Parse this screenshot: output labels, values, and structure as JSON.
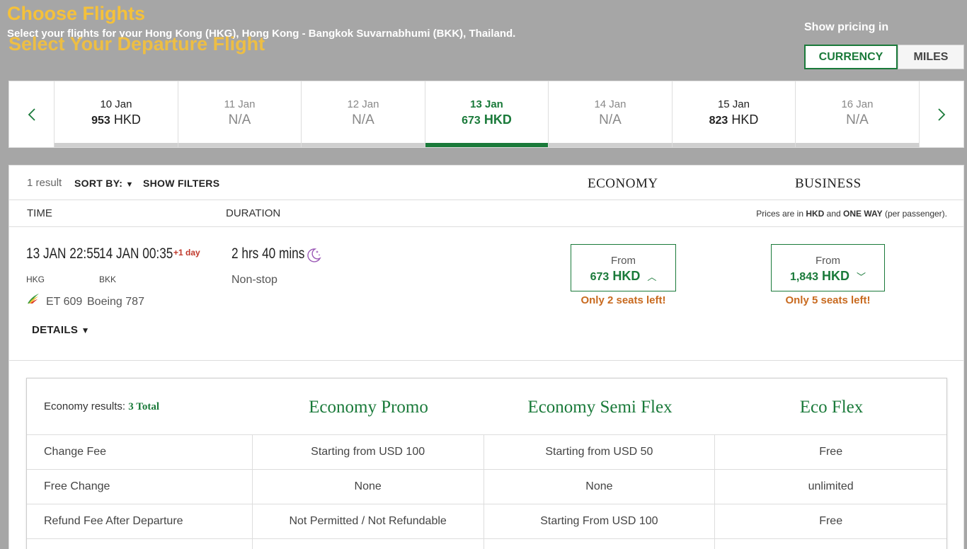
{
  "header": {
    "title": "Choose Flights",
    "subtitle": "Select your flights for your Hong Kong (HKG), Hong Kong - Bangkok Suvarnabhumi (BKK), Thailand.",
    "section_title": "Select Your Departure Flight",
    "pricing_label": "Show pricing in",
    "currency_label": "CURRENCY",
    "miles_label": "MILES"
  },
  "date_strip": {
    "prev_icon": "chevron-left-icon",
    "next_icon": "chevron-right-icon",
    "dates": [
      {
        "label": "10 Jan",
        "amount": "953",
        "unit": "HKD",
        "available": true,
        "active": false
      },
      {
        "label": "11 Jan",
        "amount": "",
        "unit": "N/A",
        "available": false,
        "active": false
      },
      {
        "label": "12 Jan",
        "amount": "",
        "unit": "N/A",
        "available": false,
        "active": false
      },
      {
        "label": "13 Jan",
        "amount": "673",
        "unit": "HKD",
        "available": true,
        "active": true
      },
      {
        "label": "14 Jan",
        "amount": "",
        "unit": "N/A",
        "available": false,
        "active": false
      },
      {
        "label": "15 Jan",
        "amount": "823",
        "unit": "HKD",
        "available": true,
        "active": false
      },
      {
        "label": "16 Jan",
        "amount": "",
        "unit": "N/A",
        "available": false,
        "active": false
      }
    ]
  },
  "results_bar": {
    "count": "1 result",
    "sort_by": "SORT BY:",
    "show_filters": "SHOW FILTERS",
    "economy": "ECONOMY",
    "business": "BUSINESS"
  },
  "columns": {
    "time": "TIME",
    "duration": "DURATION",
    "note_prefix": "Prices are in ",
    "note_currency": "HKD",
    "note_and": " and ",
    "note_oneway": "ONE WAY",
    "note_suffix": " (per passenger)."
  },
  "flight": {
    "departure_time": "13 JAN 22:55",
    "arrival_time": "14 JAN 00:35",
    "plus_day": "+1 day",
    "departure_code": "HKG",
    "arrival_code": "BKK",
    "flight_number": "ET 609",
    "aircraft": "Boeing 787",
    "duration": "2 hrs 40 mins",
    "stops": "Non-stop",
    "details": "DETAILS",
    "economy": {
      "from": "From",
      "amount": "673",
      "unit": "HKD",
      "seats": "Only 2 seats left!"
    },
    "business": {
      "from": "From",
      "amount": "1,843",
      "unit": "HKD",
      "seats": "Only 5 seats left!"
    }
  },
  "fare_table": {
    "results_label": "Economy results: ",
    "total": "3 Total",
    "fares": [
      "Economy Promo",
      "Economy Semi Flex",
      "Eco Flex"
    ],
    "rows": [
      {
        "label": "Change Fee",
        "values": [
          "Starting from USD 100",
          "Starting from USD 50",
          "Free"
        ]
      },
      {
        "label": "Free Change",
        "values": [
          "None",
          "None",
          "unlimited"
        ]
      },
      {
        "label": "Refund Fee After Departure",
        "values": [
          "Not Permitted / Not Refundable",
          "Starting From USD 100",
          "Free"
        ]
      },
      {
        "label": "",
        "values": [
          "",
          "",
          ""
        ]
      }
    ]
  },
  "colors": {
    "accent": "#1a7a3a",
    "title": "#f5c13a",
    "warning": "#c86a1f",
    "plus_day": "#c0392b",
    "background": "#a6a6a6"
  }
}
